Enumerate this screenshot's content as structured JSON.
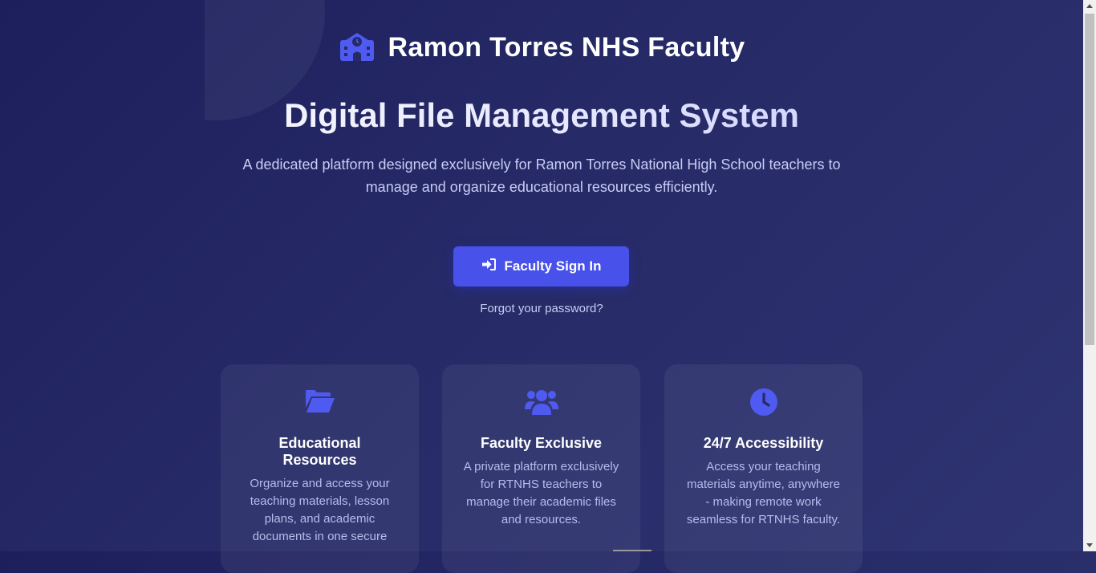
{
  "brand": {
    "title": "Ramon Torres NHS Faculty",
    "icon": "school-icon"
  },
  "hero": {
    "title": "Digital File Management System",
    "subtitle": "A dedicated platform designed exclusively for Ramon Torres National High School teachers to manage and organize educational resources efficiently."
  },
  "auth": {
    "signin_label": "Faculty Sign In",
    "signin_icon": "sign-in-icon",
    "forgot_label": "Forgot your password?"
  },
  "features": [
    {
      "icon": "folder-open-icon",
      "title": "Educational Resources",
      "text": "Organize and access your teaching materials, lesson plans, and academic documents in one secure"
    },
    {
      "icon": "users-icon",
      "title": "Faculty Exclusive",
      "text": "A private platform exclusively for RTNHS teachers to manage their academic files and resources."
    },
    {
      "icon": "clock-icon",
      "title": "24/7 Accessibility",
      "text": "Access your teaching materials anytime, anywhere - making remote work seamless for RTNHS faculty."
    }
  ],
  "colors": {
    "accent": "#4851ea",
    "background": "#262a66",
    "icon": "#4f5bf0",
    "muted_text": "#c9ccf5"
  }
}
